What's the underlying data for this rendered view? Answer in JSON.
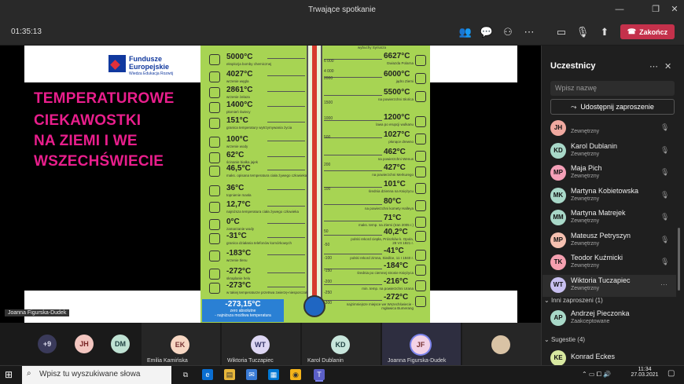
{
  "window": {
    "title": "Trwające spotkanie"
  },
  "meeting": {
    "timer": "01:35:13",
    "leave_label": "Zakończ"
  },
  "slide": {
    "logo_line1": "Fundusze",
    "logo_line2": "Europejskie",
    "logo_line3": "Wiedza Edukacja Rozwój",
    "title_lines": [
      "TEMPERATUROWE",
      "CIEKAWOSTKI",
      "NA ZIEMI I WE",
      "WSZECHŚWIECIE"
    ],
    "presenter_label": "Joanna Figurska-Dudek",
    "abs_zero_value": "-273,15°C",
    "abs_zero_text1": "zero absolutne",
    "abs_zero_text2": "- najniższa możliwa temperatura",
    "left_temps": [
      {
        "t": "5000°C",
        "d": "eksplozja bomby chemicznej"
      },
      {
        "t": "4027°C",
        "d": "wrzenie węgla"
      },
      {
        "t": "2861°C",
        "d": "wrzenie żelaza"
      },
      {
        "t": "1400°C",
        "d": "płomień świecy"
      },
      {
        "t": "151°C",
        "d": "granica temperatury wytrzymywania życia"
      },
      {
        "t": "100°C",
        "d": "wrzenie wody"
      },
      {
        "t": "62°C",
        "d": "ścinanie białka jajek"
      },
      {
        "t": "46,5°C",
        "d": "maks. opisana temperatura ciała żywego człowieka"
      },
      {
        "t": "36°C",
        "d": "topnienie masła"
      },
      {
        "t": "12,7°C",
        "d": "najniższa temperatura ciała żywego człowieka"
      },
      {
        "t": "0°C",
        "d": "zamarzanie wody"
      },
      {
        "t": "-31°C",
        "d": "granica działania telefonów komórkowych"
      },
      {
        "t": "-183°C",
        "d": "wrzenie tlenu"
      },
      {
        "t": "-272°C",
        "d": "skraplanie helu"
      },
      {
        "t": "-273°C",
        "d": "w takiej temperaturze przetrwa zwierzę-niesporczak"
      }
    ],
    "right_temps": [
      {
        "t": "6627°C",
        "d": "Gwiazda Polarna"
      },
      {
        "t": "6000°C",
        "d": "jądro Ziemi"
      },
      {
        "t": "5500°C",
        "d": "na powierzchni Słońca"
      },
      {
        "t": "1200°C",
        "d": "lawa po erupcji wulkanu"
      },
      {
        "t": "1027°C",
        "d": "płonące drewno"
      },
      {
        "t": "462°C",
        "d": "na powierzchni Wenus"
      },
      {
        "t": "427°C",
        "d": "na powierzchni Merkurego"
      },
      {
        "t": "101°C",
        "d": "średnia dzienna na Księżycu"
      },
      {
        "t": "80°C",
        "d": "na powierzchni komety Halleya"
      },
      {
        "t": "71°C",
        "d": "maks. temp. na Ziemi (Iran 2005 r.)"
      },
      {
        "t": "40,2°C",
        "d": "polski rekord ciepła, Prószków k. Opola, 29 VII 1921 r."
      },
      {
        "t": "-41°C",
        "d": "polski rekord zimna, Siedlce, 11 I 1940 r."
      },
      {
        "t": "-184°C",
        "d": "średnia po ciemnej stronie Księżyca"
      },
      {
        "t": "-216°C",
        "d": "min. temp. na powierzchni Urana"
      },
      {
        "t": "-272°C",
        "d": "najzimniejsze miejsce we Wszechświecie - mgławica Bumerang"
      }
    ],
    "scale_labels": [
      "6 000",
      "4 000",
      "2000",
      "1500",
      "1000",
      "500",
      "200",
      "100",
      "50",
      "-50",
      "-100",
      "-150",
      "-200",
      "-250",
      "-300"
    ],
    "scale_top": "wybuchy Syriusza"
  },
  "strip": {
    "more_count": "+9",
    "avatars": [
      "JH",
      "DM"
    ],
    "tiles": [
      {
        "initials": "EK",
        "name": "Emilia Kamińska"
      },
      {
        "initials": "WT",
        "name": "Wiktoria Tuczapiec"
      },
      {
        "initials": "KD",
        "name": "Karol Dublanin"
      },
      {
        "initials": "JF",
        "name": "Joanna Figurska-Dudek"
      }
    ]
  },
  "panel": {
    "title": "Uczestnicy",
    "search_placeholder": "Wpisz nazwę",
    "share_label": "Udostępnij zaproszenie",
    "participants": [
      {
        "initials": "JH",
        "name": "",
        "sub": "Zewnętrzny",
        "color": "#f0a9a0"
      },
      {
        "initials": "KD",
        "name": "Karol Dublanin",
        "sub": "Zewnętrzny",
        "color": "#a8d8c8"
      },
      {
        "initials": "MP",
        "name": "Maja Pich",
        "sub": "Zewnętrzny",
        "color": "#f5a0b8"
      },
      {
        "initials": "MK",
        "name": "Martyna Kobietowska",
        "sub": "Zewnętrzny",
        "color": "#a8d8c8"
      },
      {
        "initials": "MM",
        "name": "Martyna Matrejek",
        "sub": "Zewnętrzny",
        "color": "#a8d8c8"
      },
      {
        "initials": "MP",
        "name": "Mateusz Petryszyn",
        "sub": "Zewnętrzny",
        "color": "#f5c0b0"
      },
      {
        "initials": "TK",
        "name": "Teodor Kuźmicki",
        "sub": "Zewnętrzny",
        "color": "#f5a0b0"
      },
      {
        "initials": "WT",
        "name": "Wiktoria Tuczapiec",
        "sub": "Zewnętrzny",
        "color": "#c8c0f0"
      }
    ],
    "section_invited": "Inni zaproszeni (1)",
    "invited": {
      "initials": "AP",
      "name": "Andrzej Pieczonka",
      "sub": "Zaakceptowane",
      "color": "#a8d8c8"
    },
    "section_suggestions": "Sugestie (4)",
    "suggestion": {
      "initials": "KE",
      "name": "Konrad Eckes",
      "color": "#d8e8a0"
    }
  },
  "taskbar": {
    "search_placeholder": "Wpisz tu wyszukiwane słowa",
    "time": "11:34",
    "date": "27.03.2021"
  }
}
